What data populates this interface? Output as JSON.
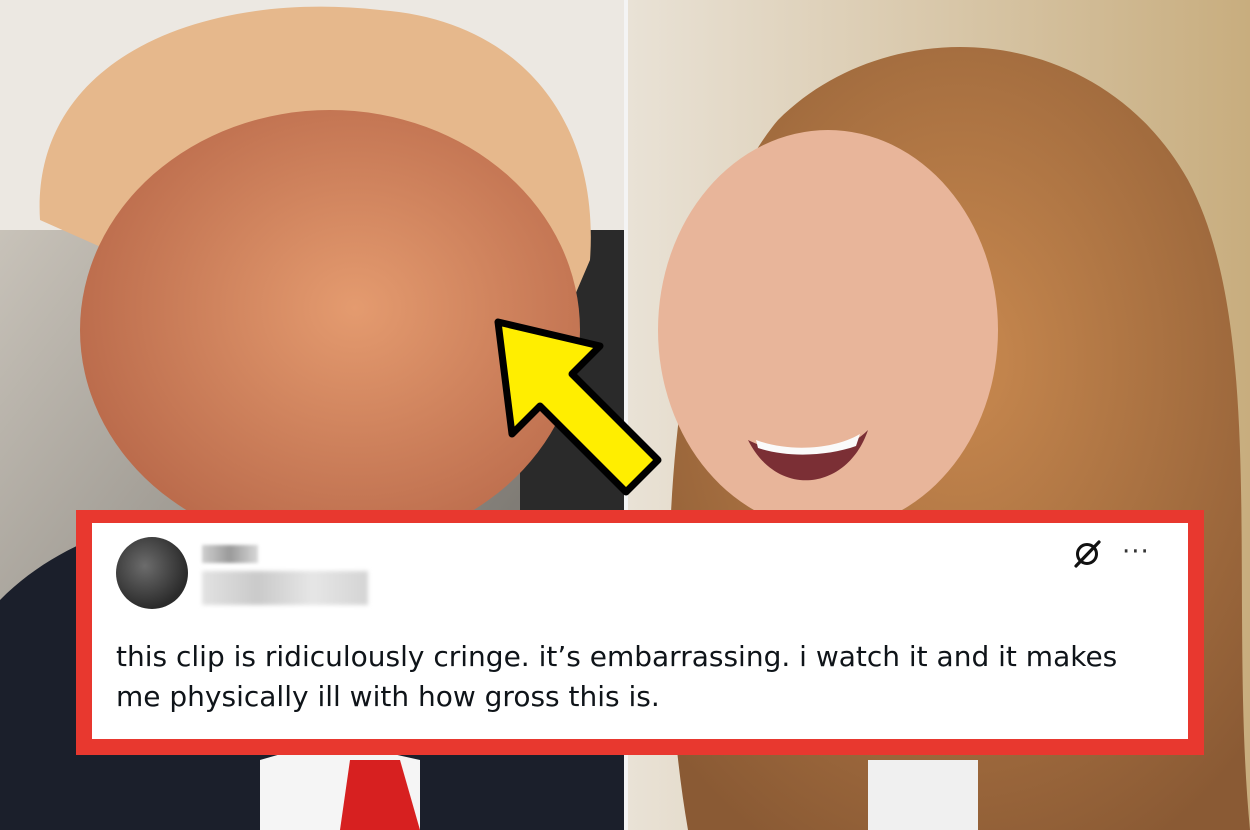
{
  "photos": {
    "left": {
      "subject": "smiling man in suit with red tie"
    },
    "right": {
      "subject": "laughing woman with long auburn hair"
    }
  },
  "annotation": {
    "arrow_color": "#ffee00",
    "arrow_icon": "arrow-up-left-icon"
  },
  "tweet": {
    "border_color": "#e8382f",
    "avatar_icon": "avatar",
    "author_name": "",
    "author_handle": "",
    "grok_icon": "grok-icon",
    "more_icon": "more-horizontal-icon",
    "more_label": "···",
    "text": "this clip is ridiculously cringe. it’s embarrassing. i watch it and it makes me physically ill with how gross this is."
  }
}
